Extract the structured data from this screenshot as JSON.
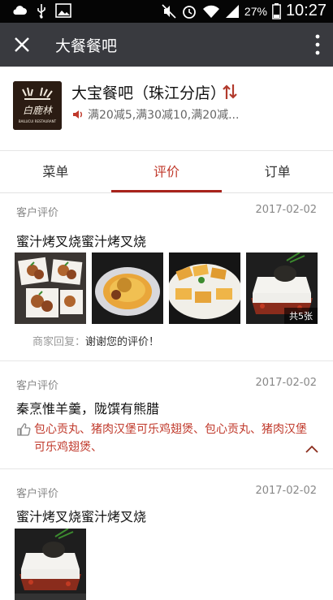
{
  "status_bar": {
    "battery": "27%",
    "time": "10:27",
    "icons": [
      "cloud-icon",
      "usb-icon",
      "image-icon",
      "mute-icon",
      "alarm-icon",
      "wifi-icon",
      "signal-icon",
      "battery-icon"
    ]
  },
  "nav": {
    "title": "大餐餐吧",
    "close_icon": "close-icon",
    "more_icon": "more-vertical-icon"
  },
  "shop": {
    "name": "大宝餐吧（珠江分店）",
    "promo": "满20减5,满30减10,满20减...",
    "logo_text": "白鹿林",
    "logo_subtext": "BAILUCUI RESTAURANT",
    "accent_color": "#a8231b"
  },
  "tabs": [
    {
      "label": "菜单",
      "active": false
    },
    {
      "label": "评价",
      "active": true
    },
    {
      "label": "订单",
      "active": false
    }
  ],
  "reviews": [
    {
      "label": "客户评价",
      "date": "2017-02-02",
      "text": "蜜汁烤叉烧蜜汁烤叉烧",
      "photo_count_label": "共5张",
      "reply_prefix": "商家回复：",
      "reply_text": "谢谢您的评价！"
    },
    {
      "label": "客户评价",
      "date": "2017-02-02",
      "text": "秦烹惟羊羹，陇馔有熊腊",
      "liked_dishes": "包心贡丸、猪肉汉堡可乐鸡翅煲、包心贡丸、猪肉汉堡可乐鸡翅煲、"
    },
    {
      "label": "客户评价",
      "date": "2017-02-02",
      "text": "蜜汁烤叉烧蜜汁烤叉烧"
    }
  ]
}
